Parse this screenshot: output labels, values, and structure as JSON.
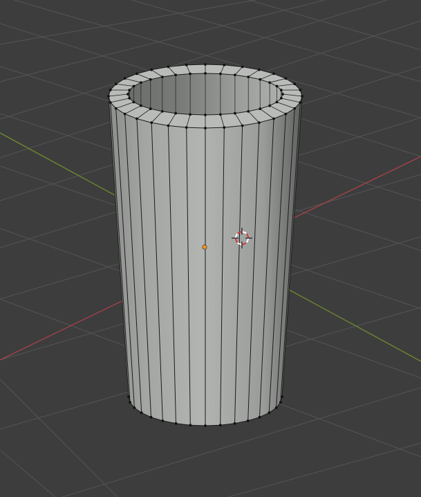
{
  "app": "Blender",
  "viewport": {
    "mode": "edit-mode",
    "view": "perspective",
    "background_color": "#3d3d3d",
    "grid_color": "#555555",
    "x_axis_color": "#a8424a",
    "y_axis_color": "#6e8f2e",
    "show_grid": true
  },
  "mesh": {
    "type": "hollow-cylinder-tube",
    "segments": 32,
    "selected": false,
    "face_color": "#a6a8a6",
    "edge_color": "#1a1a1a",
    "vertex_color": "#111111"
  },
  "origin": {
    "name": "object-origin",
    "color": "#f0931e"
  },
  "cursor_3d": {
    "name": "3d-cursor",
    "colors": [
      "#ffffff",
      "#d43a3a"
    ]
  }
}
